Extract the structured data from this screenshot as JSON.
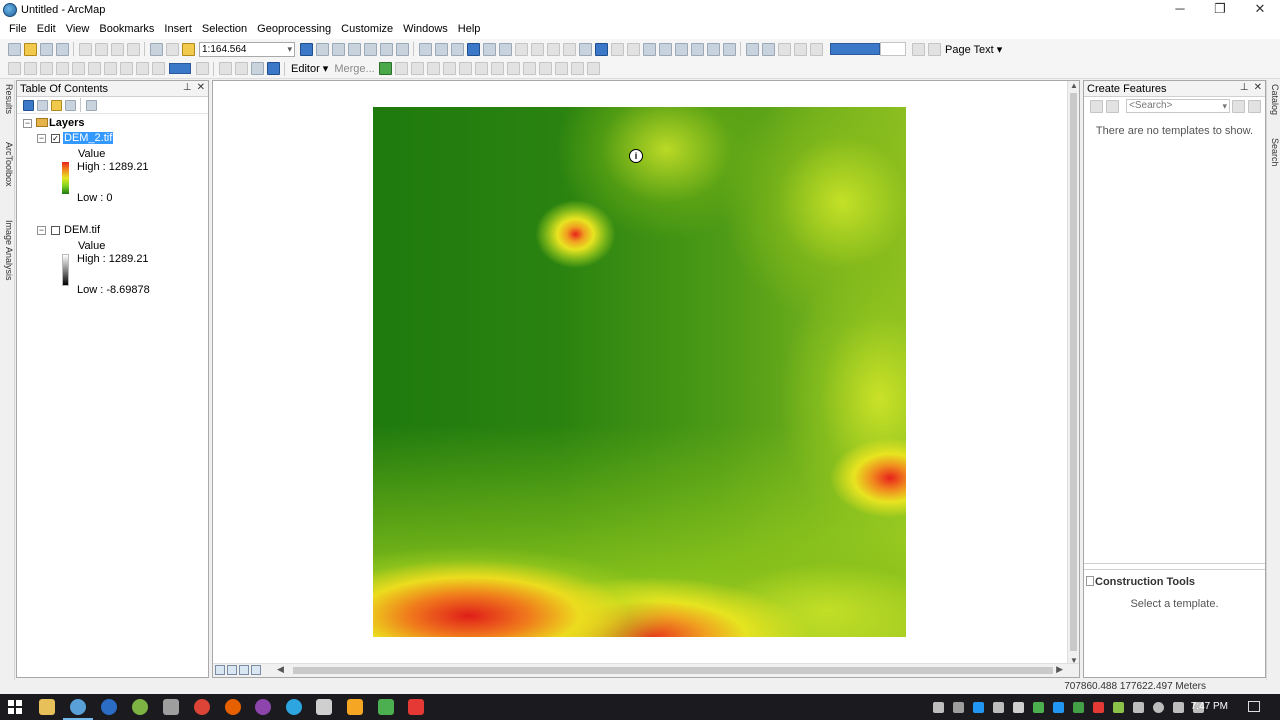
{
  "window": {
    "title": "Untitled - ArcMap",
    "minimize_glyph": "─",
    "maximize_glyph": "❐",
    "close_glyph": "✕"
  },
  "menu": [
    "File",
    "Edit",
    "View",
    "Bookmarks",
    "Insert",
    "Selection",
    "Geoprocessing",
    "Customize",
    "Windows",
    "Help"
  ],
  "toolbar": {
    "scale": "1:164.564",
    "page_text_label": "Page Text ▾",
    "editor_label": "Editor ▾",
    "merge_label": "Merge..."
  },
  "left_dock_tabs": [
    "Results",
    "ArcToolbox",
    "Image Analysis"
  ],
  "right_dock_tabs": [
    "Catalog",
    "Search"
  ],
  "toc": {
    "title": "Table Of Contents",
    "root_label": "Layers",
    "layers": [
      {
        "name": "DEM_2.tif",
        "checked": true,
        "selected": true,
        "legend_heading": "Value",
        "high": "High : 1289.21",
        "low": "Low : 0",
        "ramp": "green-yellow-red"
      },
      {
        "name": "DEM.tif",
        "checked": false,
        "selected": false,
        "legend_heading": "Value",
        "high": "High : 1289.21",
        "low": "Low : -8.69878",
        "ramp": "grayscale"
      }
    ]
  },
  "create_features": {
    "title": "Create Features",
    "search_placeholder": "<Search>",
    "empty_message": "There are no templates to show.",
    "construction_title": "Construction Tools",
    "construction_message": "Select a template."
  },
  "map": {
    "cursor_glyph": "i"
  },
  "status": {
    "coordinates": "707860.488  177622.497 Meters"
  },
  "taskbar": {
    "time": "7:47 PM"
  },
  "colors": {
    "selection": "#3399ff",
    "dem_low": "#1f7a0e",
    "dem_mid": "#e6e61e",
    "dem_high": "#e8231c"
  }
}
